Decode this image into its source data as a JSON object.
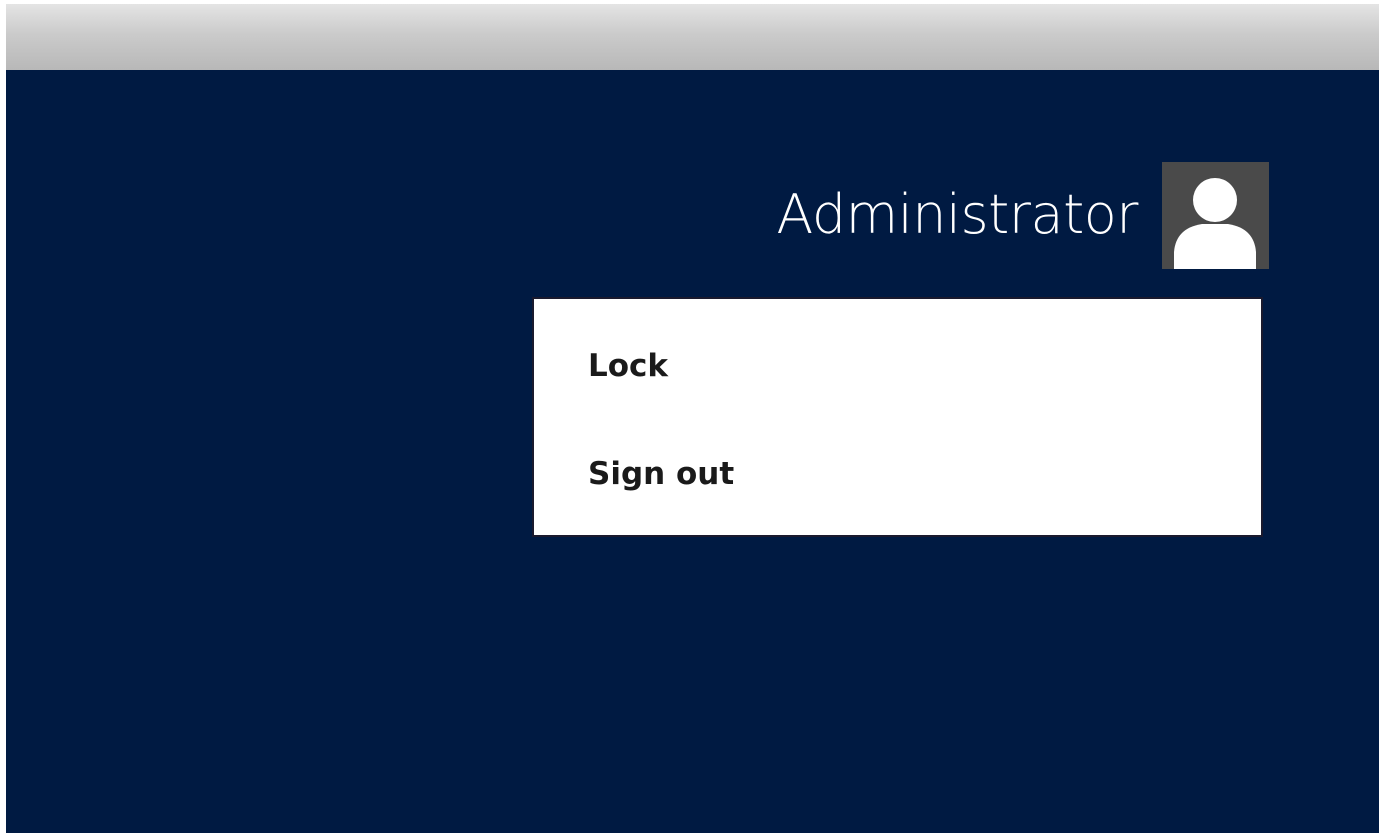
{
  "user": {
    "name": "Administrator",
    "avatar_icon": "user-silhouette-icon"
  },
  "menu": {
    "items": [
      {
        "label": "Lock"
      },
      {
        "label": "Sign out"
      }
    ]
  },
  "colors": {
    "background": "#001a42",
    "avatar_bg": "#4a4a4a",
    "menu_bg": "#ffffff",
    "menu_text": "#1a1a1a"
  }
}
